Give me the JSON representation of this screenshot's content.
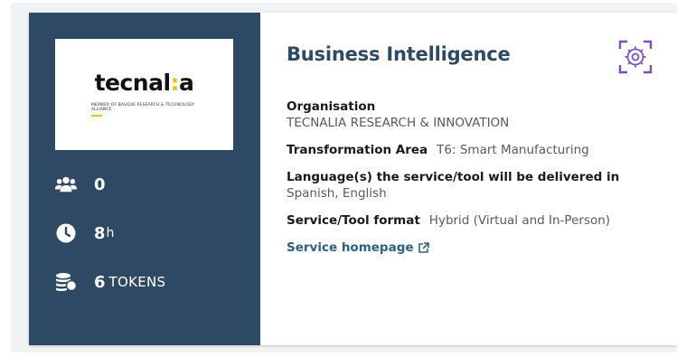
{
  "provider": {
    "logo_word_a": "tecnal",
    "logo_colon": ":",
    "logo_word_b": "a",
    "logo_subtitle": "MEMBER OF BASQUE RESEARCH & TECHNOLOGY ALLIANCE"
  },
  "stats": {
    "participants": "0",
    "hours": "8",
    "hours_unit": "h",
    "tokens": "6",
    "tokens_unit": "TOKENS"
  },
  "service": {
    "title": "Business Intelligence",
    "organisation_label": "Organisation",
    "organisation_value": "TECNALIA RESEARCH & INNOVATION",
    "area_label": "Transformation Area",
    "area_value": "T6: Smart Manufacturing",
    "language_label": "Language(s) the service/tool will be delivered in",
    "language_value": "Spanish, English",
    "format_label": "Service/Tool format",
    "format_value": "Hybrid (Virtual and In-Person)",
    "homepage_link": "Service homepage"
  },
  "colors": {
    "panel": "#2d4963",
    "title": "#2d4963",
    "link": "#2d5f88",
    "icon_accent": "#7b4fc3",
    "logo_yellow": "#f2c200"
  },
  "icons": {
    "participants": "people-group-icon",
    "hours": "clock-icon",
    "tokens": "coins-icon",
    "service_type": "gear-icon",
    "external": "external-link-icon"
  }
}
